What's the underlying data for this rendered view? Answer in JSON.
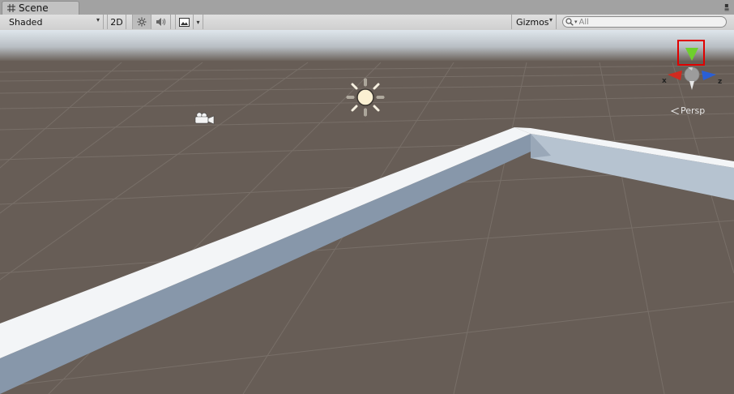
{
  "window": {
    "tab_label": "Scene",
    "tab_icon": "grid-icon",
    "menu_icon": "window-menu-icon"
  },
  "toolbar": {
    "draw_mode": "Shaded",
    "btn_2d": "2D",
    "lighting_icon": "sun-icon",
    "audio_icon": "audio-icon",
    "effects_icon": "image-icon",
    "gizmos_label": "Gizmos",
    "search_placeholder": "All"
  },
  "viewport": {
    "camera_icon": "camera-icon",
    "light_icon": "directional-light-icon",
    "gizmo": {
      "x_label": "x",
      "z_label": "z",
      "projection": "Persp",
      "colors": {
        "x": "#d12a1f",
        "y": "#6fcf2c",
        "z": "#2a5fd6",
        "highlight": "#e00000"
      }
    }
  },
  "colors": {
    "ground": "#675d56",
    "sky": "#c3c9ce",
    "wall_top": "#f2f4f6",
    "wall_side": "#8a9bad"
  }
}
